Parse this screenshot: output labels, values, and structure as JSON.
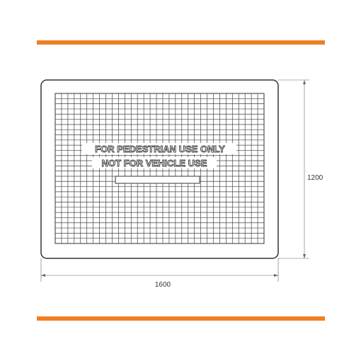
{
  "colors": {
    "accent_bar": "#f07f22",
    "line": "#333333",
    "grid": "#444444",
    "background": "#ffffff"
  },
  "cover": {
    "line1": "FOR PEDESTRIAN USE ONLY",
    "line2": "NOT FOR VEHICLE USE",
    "grid_columns": 33,
    "grid_rows": 29
  },
  "dimensions": {
    "width_label": "1600",
    "height_label": "1200"
  }
}
